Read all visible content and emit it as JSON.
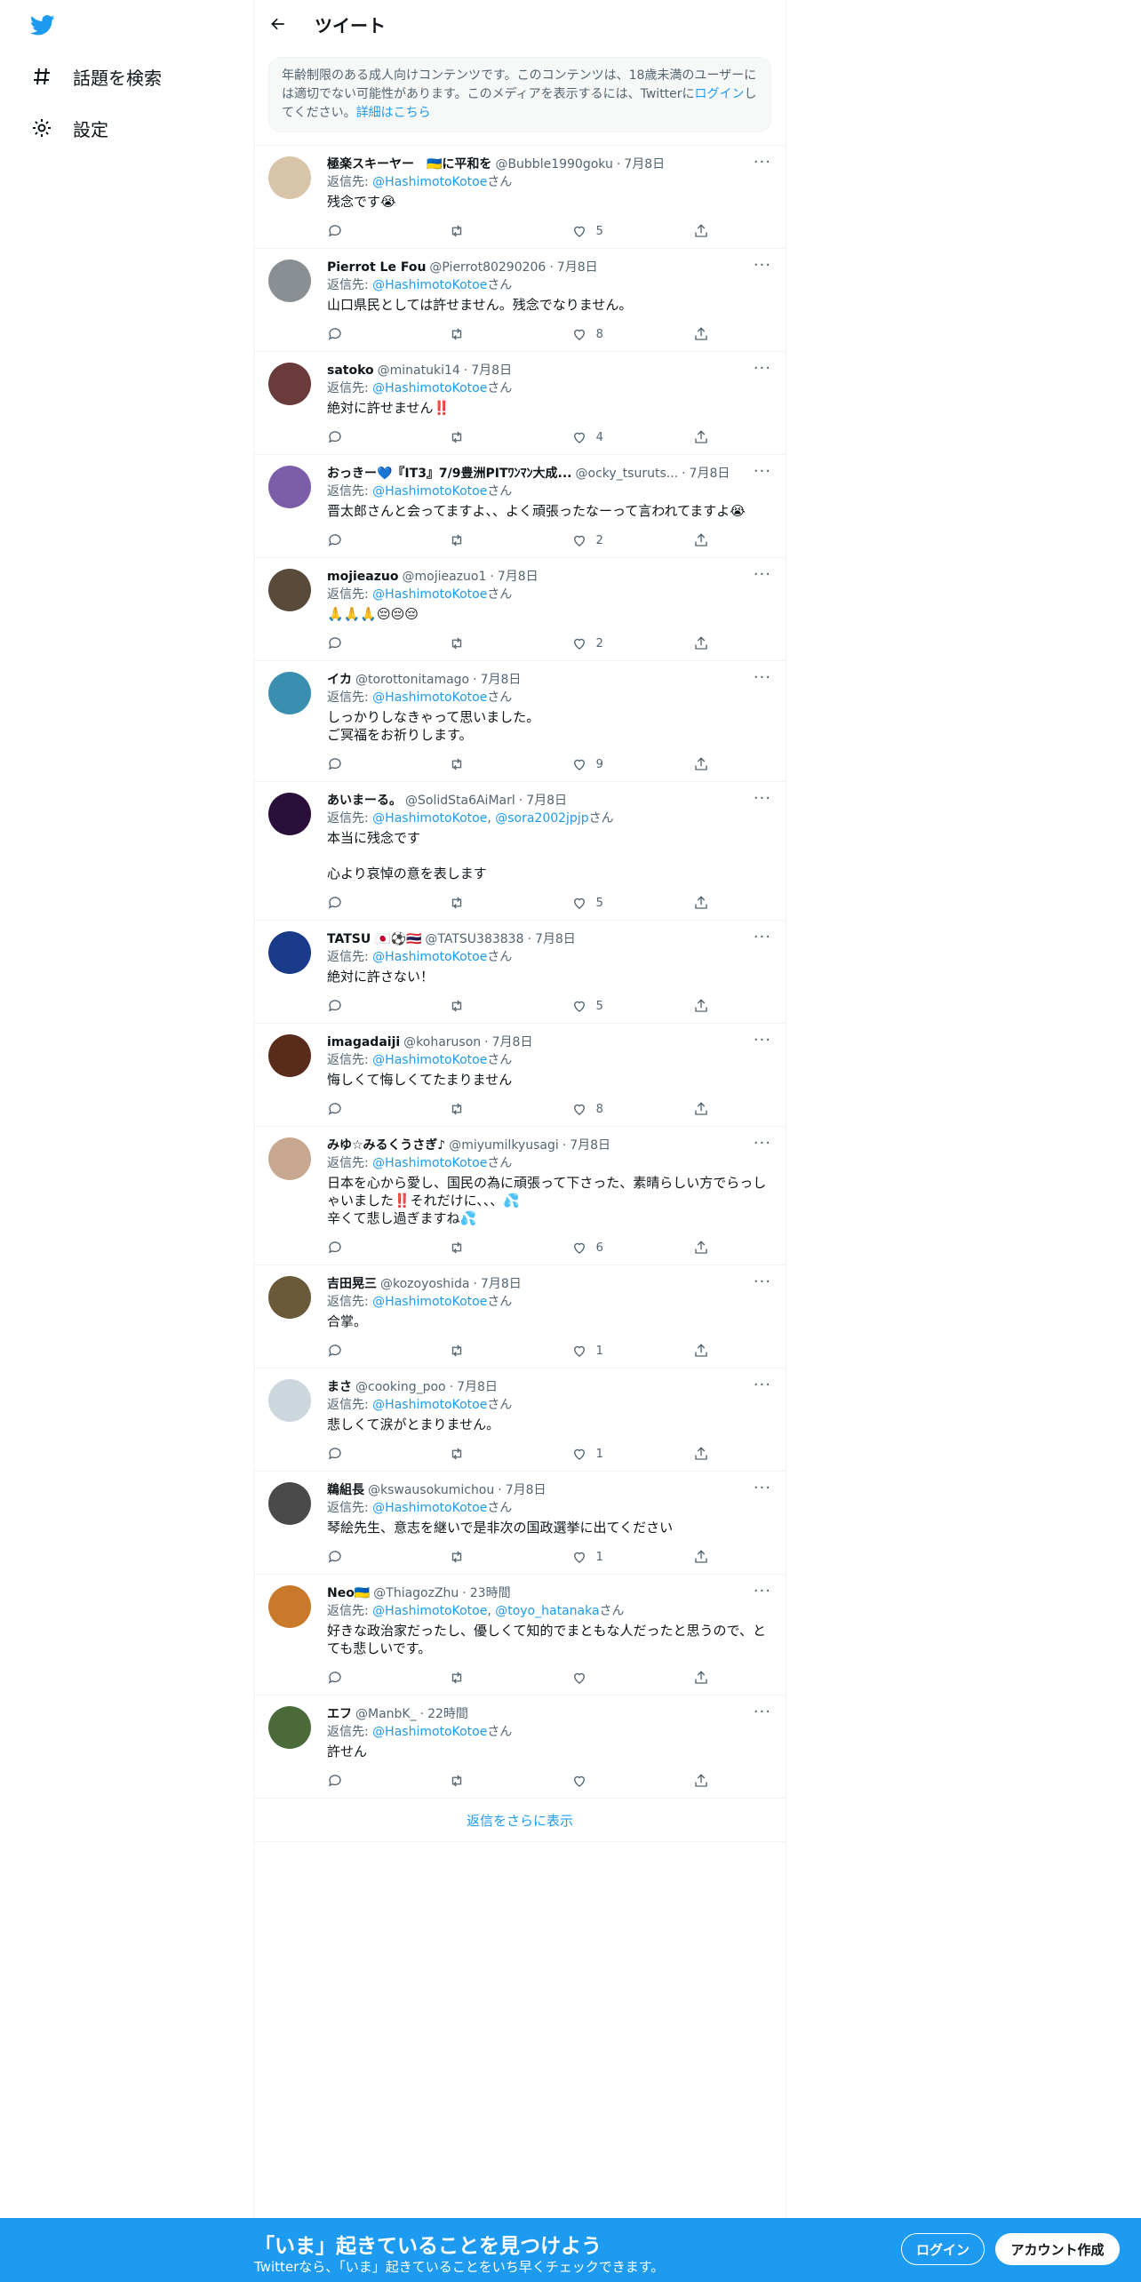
{
  "colors": {
    "accent": "#1d9bf0",
    "muted": "#536471",
    "text": "#0f1419"
  },
  "nav": {
    "explore_label": "話題を検索",
    "settings_label": "設定"
  },
  "header": {
    "title": "ツイート"
  },
  "notice": {
    "text": "年齢制限のある成人向けコンテンツです。このコンテンツは、18歳未満のユーザーには適切でない可能性があります。このメディアを表示するには、Twitterに",
    "login_link": "ログイン",
    "text2": "してください。",
    "details_link": "詳細はこちら"
  },
  "reply_prefix": "返信先: ",
  "san": "さん",
  "tweets": [
    {
      "name": "極楽スキーヤー　🇺🇦に平和を",
      "handle": "@Bubble1990goku",
      "time": "7月8日",
      "reply_to": "@HashimotoKotoe",
      "text": "残念です😭",
      "likes": "5",
      "avatar": "#d8c4a8"
    },
    {
      "name": "Pierrot Le Fou",
      "handle": "@Pierrot80290206",
      "time": "7月8日",
      "reply_to": "@HashimotoKotoe",
      "text": "山口県民としては許せません。残念でなりません。",
      "likes": "8",
      "avatar": "#8a8f94"
    },
    {
      "name": "satoko",
      "handle": "@minatuki14",
      "time": "7月8日",
      "reply_to": "@HashimotoKotoe",
      "text": "絶対に許せません‼️",
      "likes": "4",
      "avatar": "#6b3a3a"
    },
    {
      "name": "おっきー💙『IT3』7/9豊洲PITﾜﾝﾏﾝ大成...",
      "handle": "@ocky_tsuruts...",
      "time": "7月8日",
      "reply_to": "@HashimotoKotoe",
      "text": "晋太郎さんと会ってますよ、、よく頑張ったなーって言われてますよ😭",
      "likes": "2",
      "avatar": "#7b5ea7"
    },
    {
      "name": "mojieazuo",
      "handle": "@mojieazuo1",
      "time": "7月8日",
      "reply_to": "@HashimotoKotoe",
      "text": "🙏🙏🙏😔😔😔",
      "likes": "2",
      "avatar": "#5a4a3a"
    },
    {
      "name": "イカ",
      "handle": "@torottonitamago",
      "time": "7月8日",
      "reply_to": "@HashimotoKotoe",
      "text": "しっかりしなきゃって思いました。\nご冥福をお祈りします。",
      "likes": "9",
      "avatar": "#3a8fb0"
    },
    {
      "name": "あいまーる。",
      "handle": "@SolidSta6AiMarl",
      "time": "7月8日",
      "reply_to": "@HashimotoKotoe",
      "reply_to2": "@sora2002jpjp",
      "text": "本当に残念です\n\n心より哀悼の意を表します",
      "likes": "5",
      "avatar": "#2a0f3a"
    },
    {
      "name": "TATSU 🇯🇵⚽🇹🇭",
      "handle": "@TATSU383838",
      "time": "7月8日",
      "reply_to": "@HashimotoKotoe",
      "text": "絶対に許さない！",
      "likes": "5",
      "avatar": "#1a3a8a"
    },
    {
      "name": "imagadaiji",
      "handle": "@koharuson",
      "time": "7月8日",
      "reply_to": "@HashimotoKotoe",
      "text": "悔しくて悔しくてたまりません",
      "likes": "8",
      "avatar": "#5a2a1a"
    },
    {
      "name": "みゆ☆みるくうさぎ♪",
      "handle": "@miyumilkyusagi",
      "time": "7月8日",
      "reply_to": "@HashimotoKotoe",
      "text": "日本を心から愛し、国民の為に頑張って下さった、素晴らしい方でらっしゃいました‼️それだけに、、、💦\n辛くて悲し過ぎますね💦",
      "likes": "6",
      "avatar": "#c8a890"
    },
    {
      "name": "吉田晃三",
      "handle": "@kozoyoshida",
      "time": "7月8日",
      "reply_to": "@HashimotoKotoe",
      "text": "合掌。",
      "likes": "1",
      "avatar": "#6a5a3a"
    },
    {
      "name": "まさ",
      "handle": "@cooking_poo",
      "time": "7月8日",
      "reply_to": "@HashimotoKotoe",
      "text": "悲しくて涙がとまりません。",
      "likes": "1",
      "avatar": "#ccd6dd"
    },
    {
      "name": "鵜組長",
      "handle": "@kswausokumichou",
      "time": "7月8日",
      "reply_to": "@HashimotoKotoe",
      "text": "琴絵先生、意志を継いで是非次の国政選挙に出てください",
      "likes": "1",
      "avatar": "#4a4a4a"
    },
    {
      "name": "Neo🇺🇦",
      "handle": "@ThiagozZhu",
      "time": "23時間",
      "reply_to": "@HashimotoKotoe",
      "reply_to2": "@toyo_hatanaka",
      "text": "好きな政治家だったし、優しくて知的でまともな人だったと思うので、とても悲しいです。",
      "likes": "",
      "avatar": "#c87a2a"
    },
    {
      "name": "エフ",
      "handle": "@ManbK_",
      "time": "22時間",
      "reply_to": "@HashimotoKotoe",
      "text": "許せん",
      "likes": "",
      "avatar": "#4a6a3a"
    }
  ],
  "show_more": "返信をさらに表示",
  "bottom_bar": {
    "headline": "「いま」起きていることを見つけよう",
    "sub": "Twitterなら、「いま」起きていることをいち早くチェックできます。",
    "login": "ログイン",
    "signup": "アカウント作成"
  }
}
